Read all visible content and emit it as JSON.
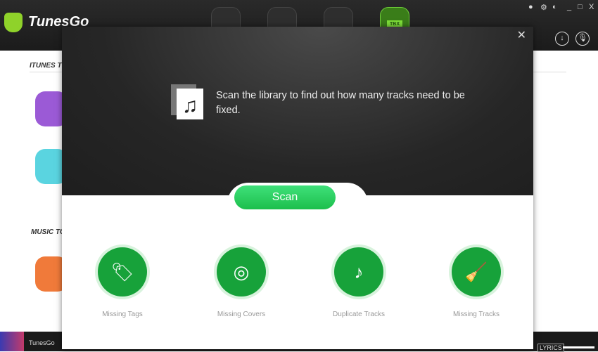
{
  "app": {
    "title": "TunesGo"
  },
  "nav_tabs": [
    {
      "icon": "headphones-icon"
    },
    {
      "icon": "music-library-icon"
    },
    {
      "icon": "phone-icon"
    },
    {
      "icon": "toolbox-icon",
      "label": "TBX",
      "active": true
    }
  ],
  "background": {
    "section1": "ITUNES T",
    "section2": "MUSIC TO",
    "player_title": "TunesGo",
    "lyrics": "LYRICS"
  },
  "modal": {
    "message": "Scan the library to find out how many tracks need to be fixed.",
    "scan_label": "Scan",
    "tools": [
      {
        "label": "Missing Tags",
        "icon": "tag-icon"
      },
      {
        "label": "Missing Covers",
        "icon": "disc-icon"
      },
      {
        "label": "Duplicate Tracks",
        "icon": "duplicate-file-icon"
      },
      {
        "label": "Missing Tracks",
        "icon": "broom-icon"
      }
    ]
  },
  "colors": {
    "accent": "#17a23a",
    "scan": "#2ed160"
  }
}
